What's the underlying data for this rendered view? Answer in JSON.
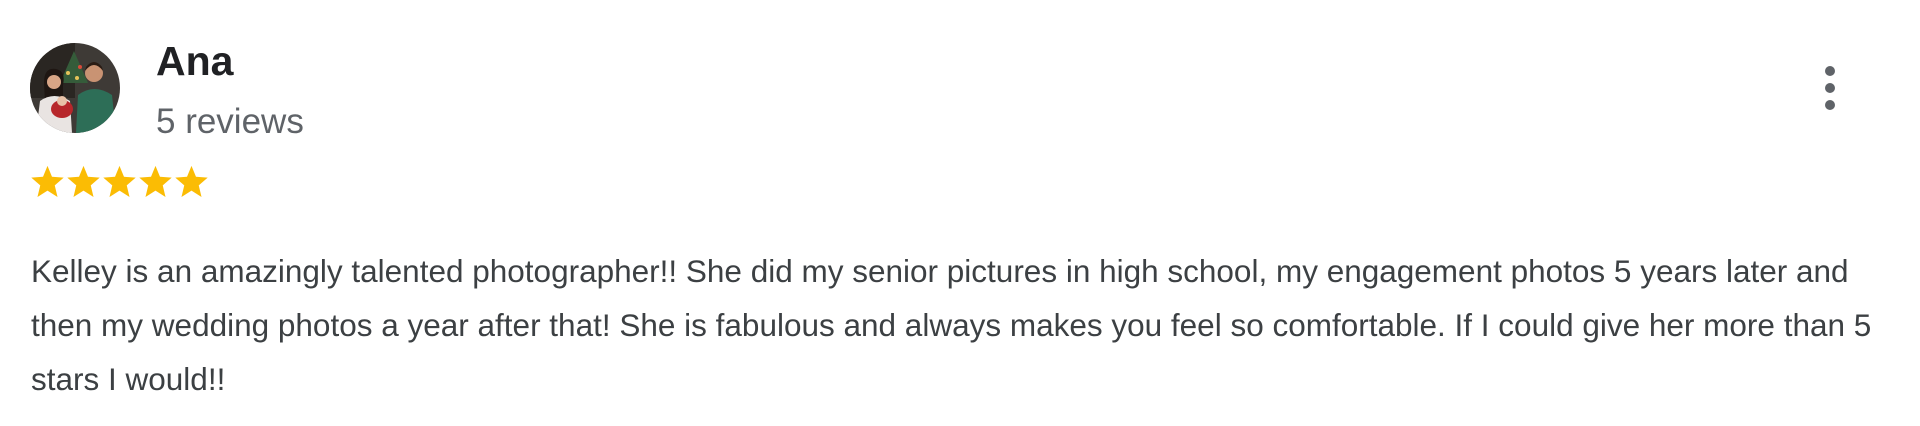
{
  "review": {
    "author": {
      "name": "Ana",
      "review_count": "5 reviews",
      "avatar": "profile-photo"
    },
    "rating": {
      "stars": 5,
      "max": 5,
      "color": "#fbbc04"
    },
    "text": "Kelley is an amazingly talented photographer!! She did my senior pictures in high school, my engagement photos 5 years later and then my wedding photos a year after that! She is fabulous and always makes you feel so comfortable. If I could give her more than 5 stars I would!!",
    "actions": {
      "more_icon": "more-vert-icon"
    }
  },
  "colors": {
    "name": "#202124",
    "secondary_text": "#5f6368",
    "body_text": "#3c4043",
    "icon": "#5f6368"
  }
}
